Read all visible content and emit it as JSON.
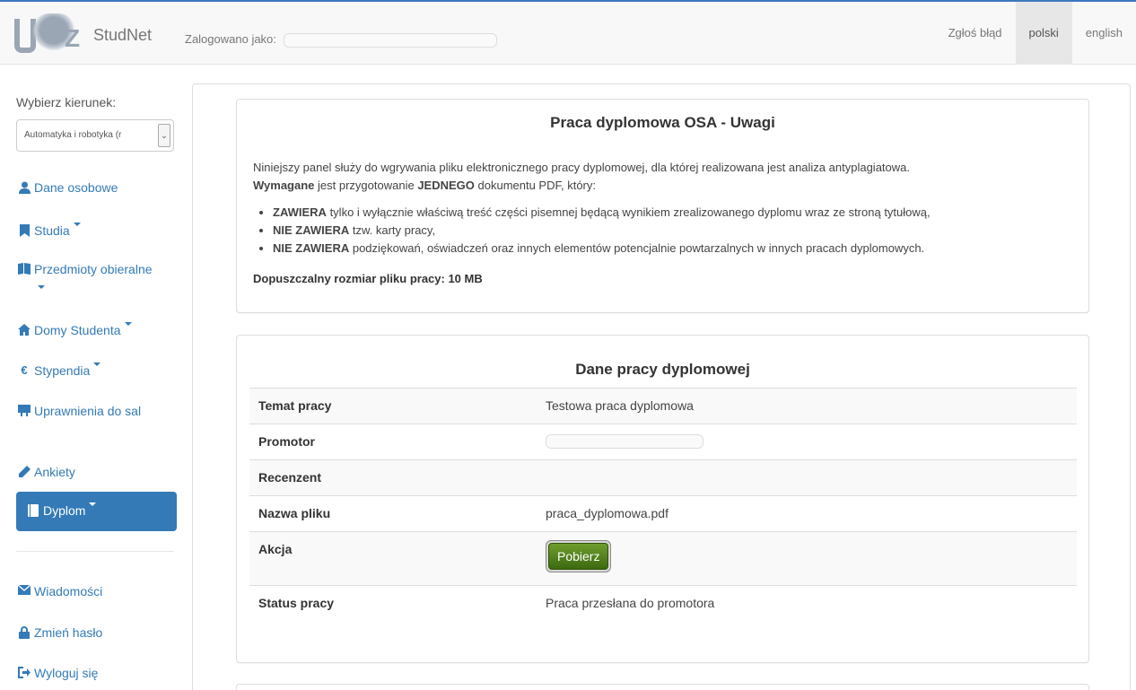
{
  "navbar": {
    "brand": "StudNet",
    "logged_label": "Zalogowano jako:",
    "links": [
      "Zgłoś błąd",
      "polski",
      "english"
    ]
  },
  "sidebar": {
    "select_label": "Wybierz kierunek:",
    "select_value": "Automatyka i robotyka (r",
    "items": [
      {
        "label": "Dane osobowe",
        "icon": "user-icon"
      },
      {
        "label": "Studia",
        "icon": "bookmark-icon"
      },
      {
        "label": "Przedmioty obieralne",
        "icon": "book-icon"
      },
      {
        "label": "Domy Studenta",
        "icon": "home-icon"
      },
      {
        "label": "Stypendia",
        "icon": "euro-icon"
      },
      {
        "label": "Uprawnienia do sal",
        "icon": "blackboard-icon"
      },
      {
        "label": "Ankiety",
        "icon": "pencil-icon"
      },
      {
        "label": "Dyplom",
        "icon": "book-icon"
      },
      {
        "label": "Wiadomości",
        "icon": "envelope-icon"
      },
      {
        "label": "Zmień hasło",
        "icon": "lock-icon"
      },
      {
        "label": "Wyloguj się",
        "icon": "logout-icon"
      }
    ]
  },
  "notice": {
    "title": "Praca dyplomowa OSA - Uwagi",
    "intro": "Niniejszy panel służy do wgrywania pliku elektronicznego pracy dyplomowej, dla której realizowana jest analiza antyplagiatowa.",
    "req_bold1": "Wymagane",
    "req_text1": " jest przygotowanie ",
    "req_bold2": "JEDNEGO",
    "req_text2": " dokumentu PDF, który:",
    "bullets": [
      {
        "bold": "ZAWIERA",
        "text": " tylko i wyłącznie właściwą treść części pisemnej będącą wynikiem zrealizowanego dyplomu wraz ze stroną tytułową,"
      },
      {
        "bold": "NIE ZAWIERA",
        "text": " tzw. karty pracy,"
      },
      {
        "bold": "NIE ZAWIERA",
        "text": " podziękowań, oświadczeń oraz innych elementów potencjalnie powtarzalnych w innych pracach dyplomowych."
      }
    ],
    "size_label": "Dopuszczalny rozmiar pliku pracy: 10 MB"
  },
  "thesis": {
    "title": "Dane pracy dyplomowej",
    "rows": [
      {
        "key": "Temat pracy",
        "value": "Testowa praca dyplomowa"
      },
      {
        "key": "Promotor",
        "value": ""
      },
      {
        "key": "Recenzent",
        "value": ""
      },
      {
        "key": "Nazwa pliku",
        "value": "praca_dyplomowa.pdf"
      },
      {
        "key": "Akcja",
        "value": ""
      },
      {
        "key": "Status pracy",
        "value": "Praca przesłana do promotora"
      }
    ],
    "download_label": "Pobierz",
    "status_color": "#d9272e"
  },
  "colors": {
    "accent": "#337ab7",
    "active_bg": "#337ab7"
  }
}
